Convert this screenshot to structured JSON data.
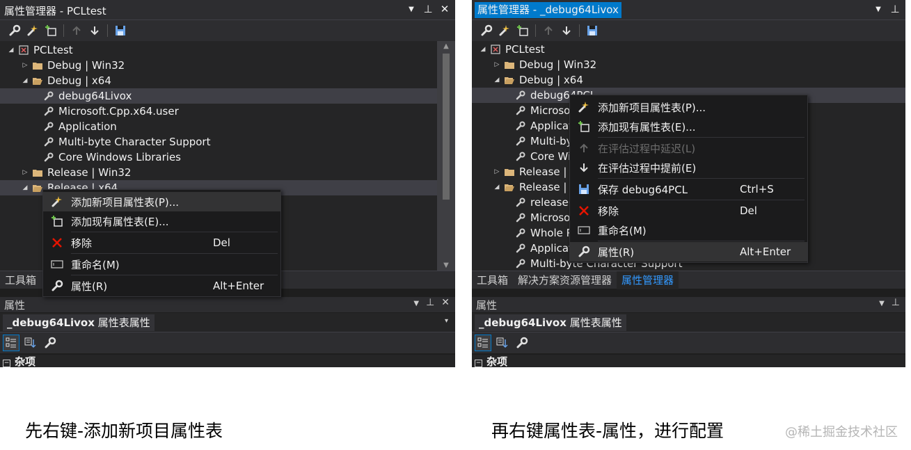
{
  "left": {
    "title": "属性管理器 - PCLtest",
    "title_buttons": [
      "▼",
      "⊥",
      "✕"
    ],
    "tree": [
      {
        "label": "PCLtest",
        "icon": "project-icon",
        "expand": "open"
      },
      {
        "label": "Debug | Win32",
        "icon": "folder-icon",
        "expand": "closed"
      },
      {
        "label": "Debug | x64",
        "icon": "folder-open-icon",
        "expand": "open"
      },
      {
        "label": "debug64Livox",
        "icon": "wrench-icon",
        "expand": "none"
      },
      {
        "label": "Microsoft.Cpp.x64.user",
        "icon": "wrench-icon",
        "expand": "none"
      },
      {
        "label": "Application",
        "icon": "wrench-icon",
        "expand": "none"
      },
      {
        "label": "Multi-byte Character Support",
        "icon": "wrench-icon",
        "expand": "none"
      },
      {
        "label": "Core Windows Libraries",
        "icon": "wrench-icon",
        "expand": "none"
      },
      {
        "label": "Release | Win32",
        "icon": "folder-icon",
        "expand": "closed"
      },
      {
        "label": "Release | x64",
        "icon": "folder-open-icon",
        "expand": "open"
      }
    ],
    "context_menu": [
      {
        "label": "添加新项目属性表(P)...",
        "shortcut": "",
        "icon": "add-new-sheet-icon"
      },
      {
        "label": "添加现有属性表(E)...",
        "shortcut": "",
        "icon": "add-existing-sheet-icon"
      },
      {
        "label": "移除",
        "shortcut": "Del",
        "icon": "remove-x-icon"
      },
      {
        "label": "重命名(M)",
        "shortcut": "",
        "icon": "rename-icon"
      },
      {
        "label": "属性(R)",
        "shortcut": "Alt+Enter",
        "icon": "wrench-icon"
      }
    ],
    "tabs": [
      "工具箱"
    ],
    "props_title": "属性",
    "props_buttons": [
      "▼",
      "⊥",
      "✕"
    ],
    "props_selection_name": "_debug64Livox",
    "props_selection_type": "属性表属性",
    "props_dropdown": "▾",
    "misc_label": "杂项",
    "misc_toggle": "−"
  },
  "right": {
    "title": "属性管理器 - _debug64Livox",
    "title_buttons": [
      "▼",
      "⊥"
    ],
    "tree": [
      {
        "label": "PCLtest",
        "icon": "project-icon",
        "expand": "open"
      },
      {
        "label": "Debug | Win32",
        "icon": "folder-icon",
        "expand": "closed"
      },
      {
        "label": "Debug | x64",
        "icon": "folder-open-icon",
        "expand": "open"
      },
      {
        "label": "debug64PCL",
        "icon": "wrench-icon",
        "expand": "none"
      },
      {
        "label": "Microsoft.Cpp.x64.user",
        "icon": "wrench-icon",
        "expand": "none"
      },
      {
        "label": "Application",
        "icon": "wrench-icon",
        "expand": "none"
      },
      {
        "label": "Multi-byte Character Support",
        "icon": "wrench-icon",
        "expand": "none"
      },
      {
        "label": "Core Windows Libraries",
        "icon": "wrench-icon",
        "expand": "none"
      },
      {
        "label": "Release | Win32",
        "icon": "folder-icon",
        "expand": "closed"
      },
      {
        "label": "Release | x64",
        "icon": "folder-open-icon",
        "expand": "open"
      },
      {
        "label": "release64",
        "icon": "wrench-icon",
        "expand": "none"
      },
      {
        "label": "Microsoft.Cpp.x64.user",
        "icon": "wrench-icon",
        "expand": "none"
      },
      {
        "label": "Whole Program Optimization",
        "icon": "wrench-icon",
        "expand": "none"
      },
      {
        "label": "Application",
        "icon": "wrench-icon",
        "expand": "none"
      },
      {
        "label": "Multi-byte Character Support",
        "icon": "wrench-icon",
        "expand": "none"
      }
    ],
    "context_menu": [
      {
        "label": "添加新项目属性表(P)...",
        "shortcut": "",
        "icon": "add-new-sheet-icon",
        "disabled": false
      },
      {
        "label": "添加现有属性表(E)...",
        "shortcut": "",
        "icon": "add-existing-sheet-icon",
        "disabled": false
      },
      {
        "label": "在评估过程中延迟(L)",
        "shortcut": "",
        "icon": "arrow-up-icon",
        "disabled": true
      },
      {
        "label": "在评估过程中提前(E)",
        "shortcut": "",
        "icon": "arrow-down-icon",
        "disabled": false
      },
      {
        "label": "保存 debug64PCL",
        "shortcut": "Ctrl+S",
        "icon": "save-icon",
        "disabled": false
      },
      {
        "label": "移除",
        "shortcut": "Del",
        "icon": "remove-x-icon",
        "disabled": false
      },
      {
        "label": "重命名(M)",
        "shortcut": "",
        "icon": "rename-icon",
        "disabled": false
      },
      {
        "label": "属性(R)",
        "shortcut": "Alt+Enter",
        "icon": "wrench-icon",
        "disabled": false
      }
    ],
    "tabs": [
      "工具箱",
      "解决方案资源管理器",
      "属性管理器"
    ],
    "props_title": "属性",
    "props_buttons": [
      "▼",
      "⊥"
    ],
    "props_selection_name": "_debug64Livox",
    "props_selection_type": "属性表属性",
    "misc_label": "杂项",
    "misc_toggle": "−"
  },
  "captions": {
    "left": "先右键-添加新项目属性表",
    "right": "再右键属性表-属性，进行配置",
    "watermark": "@稀土掘金技术社区"
  },
  "colors": {
    "accent": "#007acc",
    "active_tab": "#3399ff",
    "remove_red": "#e51400",
    "folder": "#dcb67a",
    "save_blue": "#68a2e8"
  }
}
